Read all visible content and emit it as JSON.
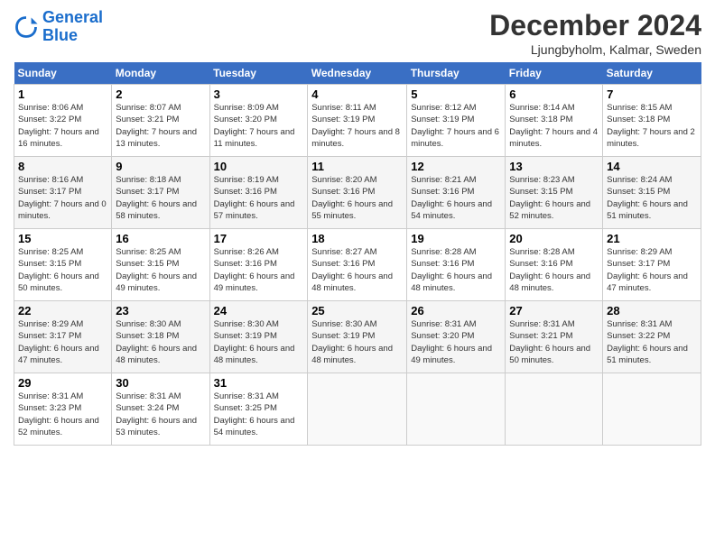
{
  "logo": {
    "line1": "General",
    "line2": "Blue"
  },
  "title": "December 2024",
  "subtitle": "Ljungbyholm, Kalmar, Sweden",
  "days_of_week": [
    "Sunday",
    "Monday",
    "Tuesday",
    "Wednesday",
    "Thursday",
    "Friday",
    "Saturday"
  ],
  "weeks": [
    [
      {
        "num": "1",
        "sunrise": "Sunrise: 8:06 AM",
        "sunset": "Sunset: 3:22 PM",
        "daylight": "Daylight: 7 hours and 16 minutes."
      },
      {
        "num": "2",
        "sunrise": "Sunrise: 8:07 AM",
        "sunset": "Sunset: 3:21 PM",
        "daylight": "Daylight: 7 hours and 13 minutes."
      },
      {
        "num": "3",
        "sunrise": "Sunrise: 8:09 AM",
        "sunset": "Sunset: 3:20 PM",
        "daylight": "Daylight: 7 hours and 11 minutes."
      },
      {
        "num": "4",
        "sunrise": "Sunrise: 8:11 AM",
        "sunset": "Sunset: 3:19 PM",
        "daylight": "Daylight: 7 hours and 8 minutes."
      },
      {
        "num": "5",
        "sunrise": "Sunrise: 8:12 AM",
        "sunset": "Sunset: 3:19 PM",
        "daylight": "Daylight: 7 hours and 6 minutes."
      },
      {
        "num": "6",
        "sunrise": "Sunrise: 8:14 AM",
        "sunset": "Sunset: 3:18 PM",
        "daylight": "Daylight: 7 hours and 4 minutes."
      },
      {
        "num": "7",
        "sunrise": "Sunrise: 8:15 AM",
        "sunset": "Sunset: 3:18 PM",
        "daylight": "Daylight: 7 hours and 2 minutes."
      }
    ],
    [
      {
        "num": "8",
        "sunrise": "Sunrise: 8:16 AM",
        "sunset": "Sunset: 3:17 PM",
        "daylight": "Daylight: 7 hours and 0 minutes."
      },
      {
        "num": "9",
        "sunrise": "Sunrise: 8:18 AM",
        "sunset": "Sunset: 3:17 PM",
        "daylight": "Daylight: 6 hours and 58 minutes."
      },
      {
        "num": "10",
        "sunrise": "Sunrise: 8:19 AM",
        "sunset": "Sunset: 3:16 PM",
        "daylight": "Daylight: 6 hours and 57 minutes."
      },
      {
        "num": "11",
        "sunrise": "Sunrise: 8:20 AM",
        "sunset": "Sunset: 3:16 PM",
        "daylight": "Daylight: 6 hours and 55 minutes."
      },
      {
        "num": "12",
        "sunrise": "Sunrise: 8:21 AM",
        "sunset": "Sunset: 3:16 PM",
        "daylight": "Daylight: 6 hours and 54 minutes."
      },
      {
        "num": "13",
        "sunrise": "Sunrise: 8:23 AM",
        "sunset": "Sunset: 3:15 PM",
        "daylight": "Daylight: 6 hours and 52 minutes."
      },
      {
        "num": "14",
        "sunrise": "Sunrise: 8:24 AM",
        "sunset": "Sunset: 3:15 PM",
        "daylight": "Daylight: 6 hours and 51 minutes."
      }
    ],
    [
      {
        "num": "15",
        "sunrise": "Sunrise: 8:25 AM",
        "sunset": "Sunset: 3:15 PM",
        "daylight": "Daylight: 6 hours and 50 minutes."
      },
      {
        "num": "16",
        "sunrise": "Sunrise: 8:25 AM",
        "sunset": "Sunset: 3:15 PM",
        "daylight": "Daylight: 6 hours and 49 minutes."
      },
      {
        "num": "17",
        "sunrise": "Sunrise: 8:26 AM",
        "sunset": "Sunset: 3:16 PM",
        "daylight": "Daylight: 6 hours and 49 minutes."
      },
      {
        "num": "18",
        "sunrise": "Sunrise: 8:27 AM",
        "sunset": "Sunset: 3:16 PM",
        "daylight": "Daylight: 6 hours and 48 minutes."
      },
      {
        "num": "19",
        "sunrise": "Sunrise: 8:28 AM",
        "sunset": "Sunset: 3:16 PM",
        "daylight": "Daylight: 6 hours and 48 minutes."
      },
      {
        "num": "20",
        "sunrise": "Sunrise: 8:28 AM",
        "sunset": "Sunset: 3:16 PM",
        "daylight": "Daylight: 6 hours and 48 minutes."
      },
      {
        "num": "21",
        "sunrise": "Sunrise: 8:29 AM",
        "sunset": "Sunset: 3:17 PM",
        "daylight": "Daylight: 6 hours and 47 minutes."
      }
    ],
    [
      {
        "num": "22",
        "sunrise": "Sunrise: 8:29 AM",
        "sunset": "Sunset: 3:17 PM",
        "daylight": "Daylight: 6 hours and 47 minutes."
      },
      {
        "num": "23",
        "sunrise": "Sunrise: 8:30 AM",
        "sunset": "Sunset: 3:18 PM",
        "daylight": "Daylight: 6 hours and 48 minutes."
      },
      {
        "num": "24",
        "sunrise": "Sunrise: 8:30 AM",
        "sunset": "Sunset: 3:19 PM",
        "daylight": "Daylight: 6 hours and 48 minutes."
      },
      {
        "num": "25",
        "sunrise": "Sunrise: 8:30 AM",
        "sunset": "Sunset: 3:19 PM",
        "daylight": "Daylight: 6 hours and 48 minutes."
      },
      {
        "num": "26",
        "sunrise": "Sunrise: 8:31 AM",
        "sunset": "Sunset: 3:20 PM",
        "daylight": "Daylight: 6 hours and 49 minutes."
      },
      {
        "num": "27",
        "sunrise": "Sunrise: 8:31 AM",
        "sunset": "Sunset: 3:21 PM",
        "daylight": "Daylight: 6 hours and 50 minutes."
      },
      {
        "num": "28",
        "sunrise": "Sunrise: 8:31 AM",
        "sunset": "Sunset: 3:22 PM",
        "daylight": "Daylight: 6 hours and 51 minutes."
      }
    ],
    [
      {
        "num": "29",
        "sunrise": "Sunrise: 8:31 AM",
        "sunset": "Sunset: 3:23 PM",
        "daylight": "Daylight: 6 hours and 52 minutes."
      },
      {
        "num": "30",
        "sunrise": "Sunrise: 8:31 AM",
        "sunset": "Sunset: 3:24 PM",
        "daylight": "Daylight: 6 hours and 53 minutes."
      },
      {
        "num": "31",
        "sunrise": "Sunrise: 8:31 AM",
        "sunset": "Sunset: 3:25 PM",
        "daylight": "Daylight: 6 hours and 54 minutes."
      },
      null,
      null,
      null,
      null
    ]
  ]
}
